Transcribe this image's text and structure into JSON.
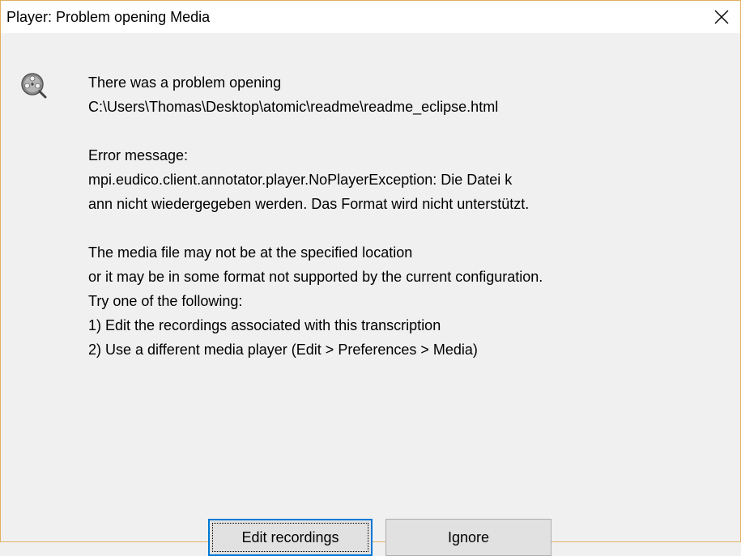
{
  "window": {
    "title": "Player: Problem opening Media",
    "close_icon": "close-icon"
  },
  "dialog": {
    "icon": "media-reel-icon",
    "message_lines": [
      "There was a problem opening",
      "C:\\Users\\Thomas\\Desktop\\atomic\\readme\\readme_eclipse.html",
      "",
      "Error message:",
      "mpi.eudico.client.annotator.player.NoPlayerException: Die Datei k",
      "ann nicht wiedergegeben werden. Das Format wird nicht unterstützt.",
      "",
      "The media file may not be at the specified location",
      "or it may be in some format not supported by the current configuration.",
      "Try one of the following:",
      "1) Edit the recordings associated with this transcription",
      "2) Use a different media player (Edit > Preferences > Media)"
    ]
  },
  "buttons": {
    "edit_recordings": "Edit recordings",
    "ignore": "Ignore"
  },
  "colors": {
    "window_border": "#e0b060",
    "focus_accent": "#0078d7",
    "button_face": "#e1e1e1",
    "dialog_background": "#f0f0f0"
  }
}
